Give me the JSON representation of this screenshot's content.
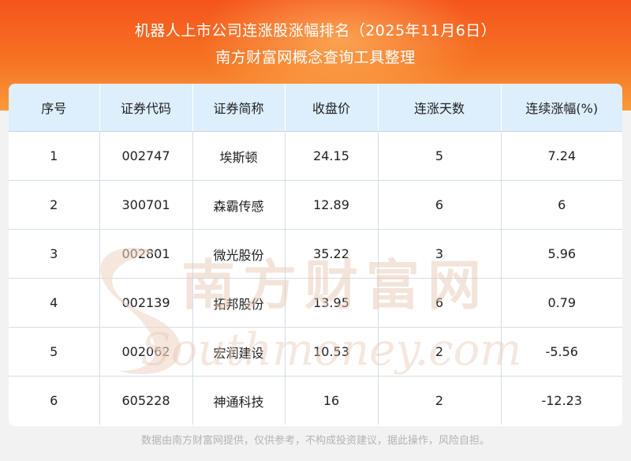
{
  "header": {
    "title": "机器人上市公司连涨股涨幅排名（2025年11月6日）",
    "subtitle": "南方财富网概念查询工具整理"
  },
  "table": {
    "columns": [
      "序号",
      "证券代码",
      "证券简称",
      "收盘价",
      "连涨天数",
      "连续涨幅(%)"
    ],
    "rows": [
      [
        "1",
        "002747",
        "埃斯顿",
        "24.15",
        "5",
        "7.24"
      ],
      [
        "2",
        "300701",
        "森霸传感",
        "12.89",
        "6",
        "6"
      ],
      [
        "3",
        "002801",
        "微光股份",
        "35.22",
        "3",
        "5.96"
      ],
      [
        "4",
        "002139",
        "拓邦股份",
        "13.95",
        "6",
        "0.79"
      ],
      [
        "5",
        "002062",
        "宏润建设",
        "10.53",
        "2",
        "-5.56"
      ],
      [
        "6",
        "605228",
        "神通科技",
        "16",
        "2",
        "-12.23"
      ]
    ]
  },
  "watermark": {
    "cn": "南方财富网",
    "en": "Southmoney.com"
  },
  "footer": {
    "disclaimer": "数据由南方财富网提供，仅供参考，不构成投资建议，据此操作，风险自担。"
  },
  "colors": {
    "header_top": "#f5541c",
    "header_bottom": "#f99a3a",
    "table_header_bg": "#ddeefd",
    "watermark": "#e8c9b8"
  }
}
